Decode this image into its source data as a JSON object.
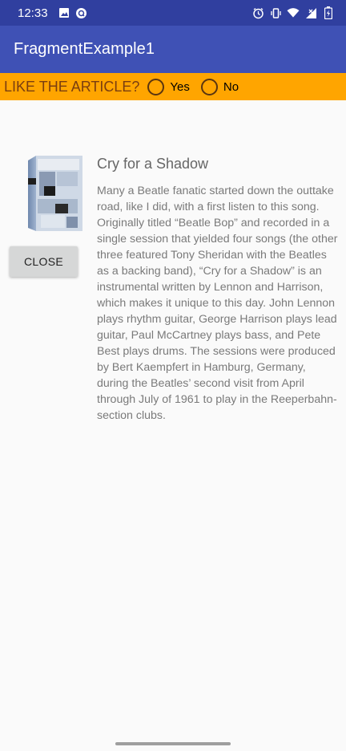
{
  "status_bar": {
    "time": "12:33",
    "left_icons": [
      "image-icon",
      "notification-icon"
    ],
    "right_icons": [
      "alarm-icon",
      "vibrate-icon",
      "wifi-icon",
      "signal-icon",
      "battery-icon"
    ]
  },
  "app_bar": {
    "title": "FragmentExample1",
    "color": "#3f51b5"
  },
  "like_bar": {
    "label": "LIKE THE ARTICLE?",
    "options": [
      {
        "label": "Yes",
        "selected": false
      },
      {
        "label": "No",
        "selected": false
      }
    ],
    "color": "#ffa500"
  },
  "close_button": {
    "label": "CLOSE"
  },
  "article": {
    "title": "Cry for a Shadow",
    "body": "Many a Beatle fanatic started down the outtake road, like I did, with a first listen to this song. Originally titled “Beatle Bop” and recorded in a single session that yielded four songs (the other three featured Tony Sheridan with the Beatles as a backing band), “Cry for a Shadow” is an instrumental written by Lennon and Harrison, which makes it unique to this day. John Lennon plays rhythm guitar, George Harrison plays lead guitar, Paul McCartney plays bass, and Pete Best plays drums. The sessions were produced by Bert Kaempfert in Hamburg, Germany, during the Beatles’ second visit from April through July of 1961 to play in the Reeperbahn-section clubs."
  }
}
